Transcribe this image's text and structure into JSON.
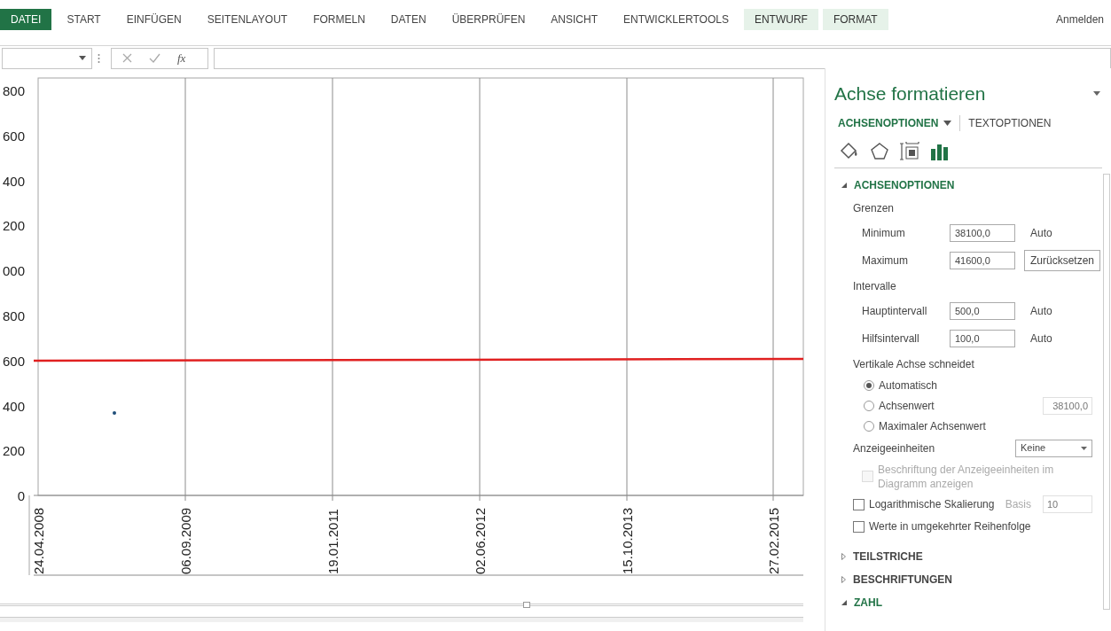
{
  "ribbon": {
    "tabs": [
      {
        "label": "DATEI",
        "kind": "file",
        "selected": false
      },
      {
        "label": "START",
        "kind": "normal",
        "selected": false
      },
      {
        "label": "EINFÜGEN",
        "kind": "normal",
        "selected": false
      },
      {
        "label": "SEITENLAYOUT",
        "kind": "normal",
        "selected": false
      },
      {
        "label": "FORMELN",
        "kind": "normal",
        "selected": false
      },
      {
        "label": "DATEN",
        "kind": "normal",
        "selected": false
      },
      {
        "label": "ÜBERPRÜFEN",
        "kind": "normal",
        "selected": false
      },
      {
        "label": "ANSICHT",
        "kind": "normal",
        "selected": false
      },
      {
        "label": "ENTWICKLERTOOLS",
        "kind": "normal",
        "selected": false
      },
      {
        "label": "ENTWURF",
        "kind": "contextual",
        "selected": false
      },
      {
        "label": "FORMAT",
        "kind": "contextual",
        "selected": false
      }
    ],
    "sign_in": "Anmelden"
  },
  "formula_bar": {
    "function_label": "fx"
  },
  "chart": {
    "y_labels": [
      "800",
      "600",
      "400",
      "200",
      "000",
      "800",
      "600",
      "400",
      "200",
      "0"
    ],
    "x_labels": [
      "24.04.2008",
      "06.09.2009",
      "19.01.2011",
      "02.06.2012",
      "15.10.2013",
      "27.02.2015"
    ]
  },
  "panel": {
    "title": "Achse formatieren",
    "tabs": [
      {
        "label": "ACHSENOPTIONEN",
        "selected": true
      },
      {
        "label": "TEXTOPTIONEN",
        "selected": false
      }
    ],
    "icon_tabs": [
      {
        "kind": "fill",
        "selected": false
      },
      {
        "kind": "effects",
        "selected": false
      },
      {
        "kind": "size",
        "selected": false
      },
      {
        "kind": "axis",
        "selected": true
      }
    ],
    "sections": [
      {
        "title": "ACHSENOPTIONEN",
        "expanded": true,
        "rows": [
          {
            "kind": "group",
            "label": "Grenzen"
          },
          {
            "kind": "field",
            "label": "Minimum",
            "value": "38100,0",
            "action": {
              "kind": "text",
              "label": "Auto"
            }
          },
          {
            "kind": "field",
            "label": "Maximum",
            "value": "41600,0",
            "action": {
              "kind": "button",
              "label": "Zurücksetzen"
            }
          },
          {
            "kind": "group",
            "label": "Intervalle"
          },
          {
            "kind": "field",
            "label": "Hauptintervall",
            "value": "500,0",
            "action": {
              "kind": "text",
              "label": "Auto"
            }
          },
          {
            "kind": "field",
            "label": "Hilfsintervall",
            "value": "100,0",
            "action": {
              "kind": "text",
              "label": "Auto"
            }
          },
          {
            "kind": "group",
            "label": "Vertikale Achse schneidet"
          },
          {
            "kind": "radio",
            "label": "Automatisch",
            "selected": true
          },
          {
            "kind": "radio",
            "label": "Achsenwert",
            "selected": false,
            "value": "38100,0"
          },
          {
            "kind": "radio",
            "label": "Maximaler Achsenwert",
            "selected": false
          },
          {
            "kind": "dropdown",
            "label": "Anzeigeeinheiten",
            "value": "Keine"
          },
          {
            "kind": "checkbox",
            "label": "Beschriftung der Anzeigeeinheiten im Diagramm anzeigen",
            "checked": false,
            "disabled": true
          },
          {
            "kind": "checkbox",
            "label": "Logarithmische Skalierung",
            "checked": false,
            "disabled": false,
            "extra_label": "Basis",
            "extra_value": "10"
          },
          {
            "kind": "checkbox",
            "label": "Werte in umgekehrter Reihenfolge",
            "checked": false,
            "disabled": false
          }
        ]
      },
      {
        "title": "TEILSTRICHE",
        "expanded": false
      },
      {
        "title": "BESCHRIFTUNGEN",
        "expanded": false
      },
      {
        "title": "ZAHL",
        "expanded": true
      }
    ]
  }
}
